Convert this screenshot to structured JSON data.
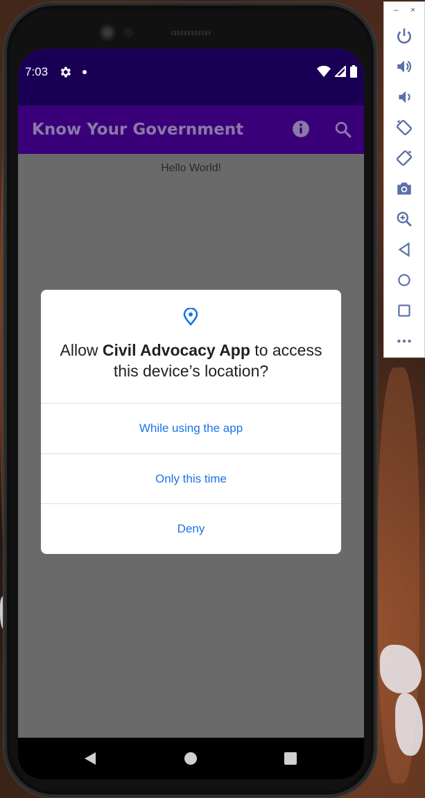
{
  "status_bar": {
    "time": "7:03",
    "icons": [
      "gear-icon",
      "notification-dot",
      "wifi-icon",
      "signal-icon",
      "battery-icon"
    ]
  },
  "app_bar": {
    "title": "Know Your Government",
    "actions": [
      "info-icon",
      "search-icon"
    ]
  },
  "main": {
    "hello_text": "Hello World!"
  },
  "permission_dialog": {
    "icon": "location-pin-icon",
    "message_prefix": "Allow ",
    "app_name": "Civil Advocacy App",
    "message_suffix": " to access this device’s location?",
    "options": [
      {
        "label": "While using the app"
      },
      {
        "label": "Only this time"
      },
      {
        "label": "Deny"
      }
    ]
  },
  "nav_bar": {
    "buttons": [
      "back-icon",
      "home-icon",
      "recents-icon"
    ]
  },
  "emulator_panel": {
    "window_controls": {
      "minimize": "–",
      "close": "×"
    },
    "buttons": [
      "power-icon",
      "volume-up-icon",
      "volume-down-icon",
      "rotate-left-icon",
      "rotate-right-icon",
      "camera-icon",
      "zoom-icon",
      "back-icon",
      "home-icon",
      "overview-icon",
      "more-icon"
    ]
  },
  "colors": {
    "status_bar": "#1a0055",
    "app_bar": "#3a007a",
    "accent": "#1a73e8",
    "scrim": "#6a6a6a"
  }
}
